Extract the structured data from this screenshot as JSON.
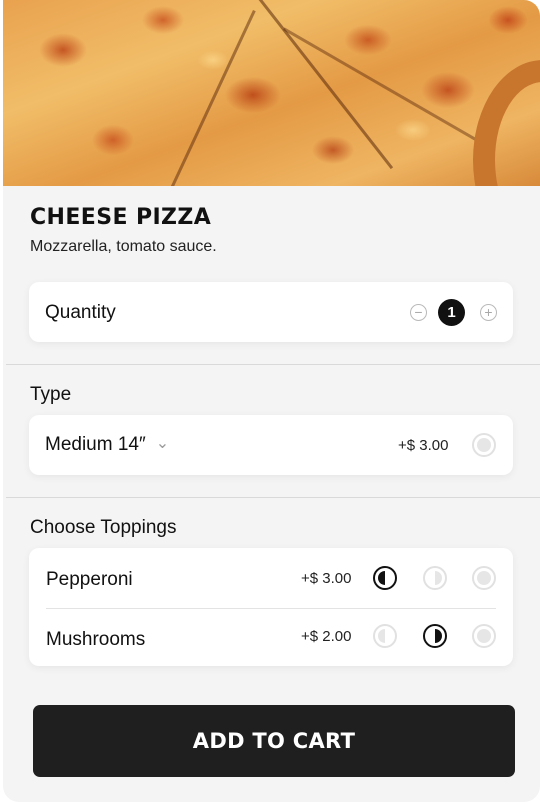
{
  "product": {
    "name": "CHEESE PIZZA",
    "description": "Mozzarella, tomato sauce."
  },
  "quantity": {
    "label": "Quantity",
    "value": "1",
    "decrement_symbol": "−",
    "increment_symbol": "+"
  },
  "type": {
    "section_label": "Type",
    "selected": "Medium 14″",
    "chevron": "⌄",
    "price": "+$ 3.00"
  },
  "toppings": {
    "section_label": "Choose Toppings",
    "items": [
      {
        "name": "Pepperoni",
        "price": "+$ 3.00",
        "portion_selected": "left-half"
      },
      {
        "name": "Mushrooms",
        "price": "+$ 2.00",
        "portion_selected": "right-half"
      }
    ]
  },
  "cart": {
    "button_label": "ADD TO CART"
  },
  "colors": {
    "accent": "#111111",
    "button_bg": "#1f1f1f",
    "background": "#f4f4f4"
  }
}
